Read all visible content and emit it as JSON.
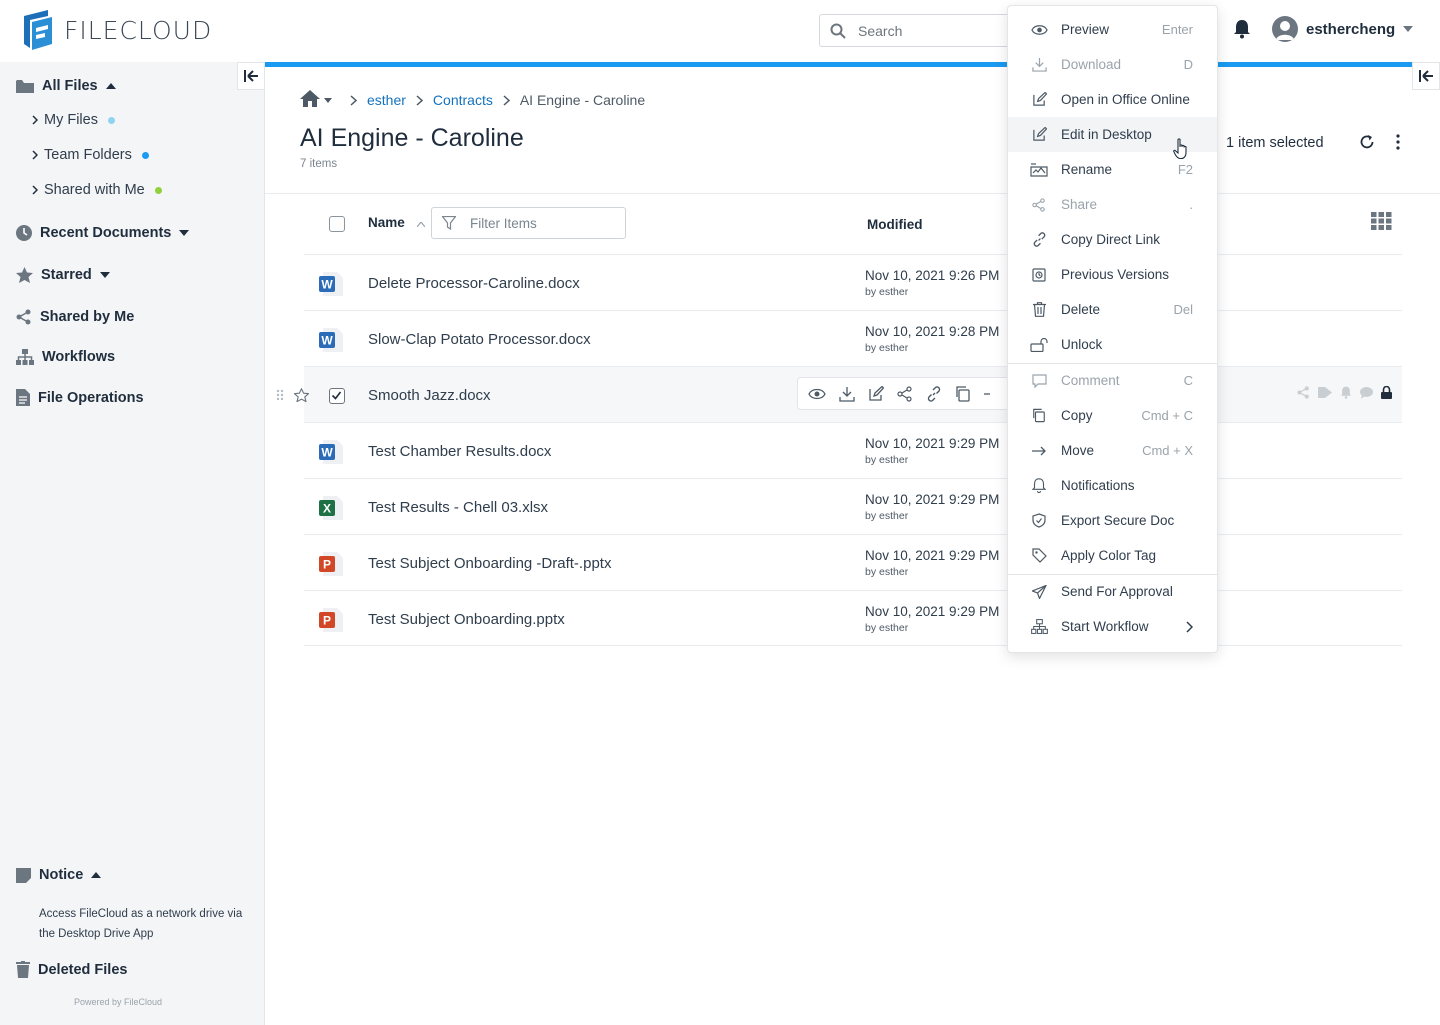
{
  "app": {
    "logo_text": "FILECLOUD"
  },
  "search": {
    "placeholder": "Search"
  },
  "user": {
    "name": "esthercheng"
  },
  "sidebar": {
    "all_files": "All Files",
    "my_files": "My Files",
    "team_folders": "Team Folders",
    "shared_with_me": "Shared with Me",
    "recent_documents": "Recent Documents",
    "starred": "Starred",
    "shared_by_me": "Shared by Me",
    "workflows": "Workflows",
    "file_operations": "File Operations",
    "notice": "Notice",
    "notice_text": "Access FileCloud as a network drive via the Desktop Drive App",
    "deleted_files": "Deleted Files",
    "powered_by": "Powered by FileCloud"
  },
  "breadcrumb": {
    "items": [
      "esther",
      "Contracts",
      "AI Engine - Caroline"
    ]
  },
  "folder": {
    "title": "AI Engine - Caroline",
    "count": "7 items",
    "selected": "1 item selected"
  },
  "table": {
    "col_name": "Name",
    "col_modified": "Modified",
    "filter_placeholder": "Filter Items",
    "rows": [
      {
        "name": "Delete Processor-Caroline.docx",
        "type": "word",
        "modified": "Nov 10, 2021 9:26 PM",
        "by": "by esther"
      },
      {
        "name": "Slow-Clap Potato Processor.docx",
        "type": "word",
        "modified": "Nov 10, 2021 9:28 PM",
        "by": "by esther"
      },
      {
        "name": "Smooth Jazz.docx",
        "type": "word",
        "modified": "",
        "by": ""
      },
      {
        "name": "Test Chamber Results.docx",
        "type": "word",
        "modified": "Nov 10, 2021 9:29 PM",
        "by": "by esther"
      },
      {
        "name": "Test Results - Chell 03.xlsx",
        "type": "excel",
        "modified": "Nov 10, 2021 9:29 PM",
        "by": "by esther"
      },
      {
        "name": "Test Subject Onboarding -Draft-.pptx",
        "type": "powerpoint",
        "modified": "Nov 10, 2021 9:29 PM",
        "by": "by esther"
      },
      {
        "name": "Test Subject Onboarding.pptx",
        "type": "powerpoint",
        "modified": "Nov 10, 2021 9:29 PM",
        "by": "by esther"
      }
    ]
  },
  "context_menu": {
    "items": [
      {
        "label": "Preview",
        "shortcut": "Enter",
        "icon": "eye-icon"
      },
      {
        "label": "Download",
        "shortcut": "D",
        "icon": "download-icon"
      },
      {
        "label": "Open in Office Online",
        "shortcut": "",
        "icon": "edit-icon"
      },
      {
        "label": "Edit in Desktop",
        "shortcut": "",
        "icon": "edit-icon"
      },
      {
        "label": "Rename",
        "shortcut": "F2",
        "icon": "rename-icon"
      },
      {
        "label": "Share",
        "shortcut": ".",
        "icon": "share-icon"
      },
      {
        "label": "Copy Direct Link",
        "shortcut": "",
        "icon": "link-icon"
      },
      {
        "label": "Previous Versions",
        "shortcut": "",
        "icon": "versions-icon"
      },
      {
        "label": "Delete",
        "shortcut": "Del",
        "icon": "trash-icon"
      },
      {
        "label": "Unlock",
        "shortcut": "",
        "icon": "unlock-icon"
      },
      {
        "label": "Comment",
        "shortcut": "C",
        "icon": "comment-icon"
      },
      {
        "label": "Copy",
        "shortcut": "Cmd + C",
        "icon": "copy-icon"
      },
      {
        "label": "Move",
        "shortcut": "Cmd + X",
        "icon": "arrow-right-icon"
      },
      {
        "label": "Notifications",
        "shortcut": "",
        "icon": "bell-icon"
      },
      {
        "label": "Export Secure Doc",
        "shortcut": "",
        "icon": "shield-icon"
      },
      {
        "label": "Apply Color Tag",
        "shortcut": "",
        "icon": "tag-icon"
      },
      {
        "label": "Send For Approval",
        "shortcut": "",
        "icon": "send-icon"
      },
      {
        "label": "Start Workflow",
        "shortcut": "",
        "icon": "workflow-icon"
      }
    ]
  },
  "colors": {
    "accent": "#1a9af0",
    "link": "#1472bd",
    "team_dot": "#1a9af0",
    "my_dot": "#8fd3f0",
    "shared_dot": "#8fd13a"
  }
}
